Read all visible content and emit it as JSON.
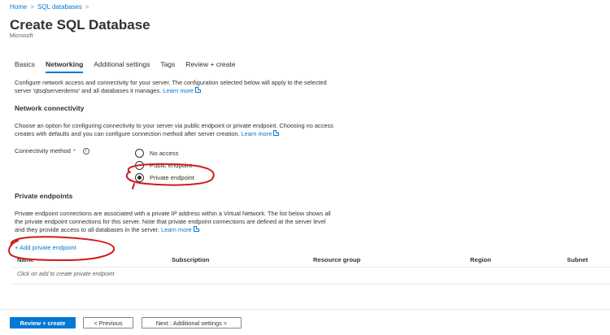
{
  "breadcrumb": {
    "home": "Home",
    "sep1": ">",
    "sql_databases": "SQL databases",
    "sep2": ">"
  },
  "header": {
    "title": "Create SQL Database",
    "subtitle": "Microsoft"
  },
  "tabs": [
    {
      "label": "Basics"
    },
    {
      "label": "Networking"
    },
    {
      "label": "Additional settings"
    },
    {
      "label": "Tags"
    },
    {
      "label": "Review + create"
    }
  ],
  "intro": {
    "line1": "Configure network access and connectivity for your server. The configuration selected below will apply to the selected",
    "line2": "server 'qtsqlserverdemo' and all databases it manages.",
    "learn_more": "Learn more"
  },
  "network": {
    "title": "Network connectivity",
    "line1": "Choose an option for configuring connectivity to your server via public endpoint or private endpoint. Choosing no access",
    "line2": "creates with defaults and you can configure connection method after server creation.",
    "learn_more": "Learn more"
  },
  "connectivity": {
    "label": "Connectivity method",
    "required_mark": "*",
    "info_glyph": "i",
    "options": [
      {
        "label": "No access"
      },
      {
        "label": "Public endpoint"
      },
      {
        "label": "Private endpoint"
      }
    ],
    "selected": "Private endpoint"
  },
  "private_endpoints": {
    "title": "Private endpoints",
    "line1": "Private endpoint connections are associated with a private IP address within a Virtual Network. The list below shows all",
    "line2": "the private endpoint connections for this server. Note that private endpoint connections are defined at the server level",
    "line3": "and they provide access to all databases in the server.",
    "learn_more": "Learn more",
    "add_label": "+ Add private endpoint",
    "columns": [
      "Name",
      "Subscription",
      "Resource group",
      "Region",
      "Subnet"
    ],
    "empty_text": "Click on add to create private endpoint"
  },
  "footer": {
    "review_create": "Review + create",
    "previous": "< Previous",
    "next": "Next : Additional settings >"
  },
  "colors": {
    "accent": "#0078d4",
    "annotation": "#d11a1a"
  }
}
